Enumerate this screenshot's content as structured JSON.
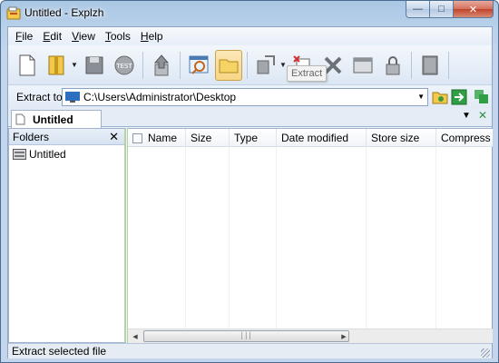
{
  "window": {
    "title": "Untitled - Explzh"
  },
  "menubar": {
    "items": [
      {
        "key": "F",
        "rest": "ile"
      },
      {
        "key": "E",
        "rest": "dit"
      },
      {
        "key": "V",
        "rest": "iew"
      },
      {
        "key": "T",
        "rest": "ools"
      },
      {
        "key": "H",
        "rest": "elp"
      }
    ]
  },
  "toolbar": {
    "tooltip": "Extract"
  },
  "extractbar": {
    "label": "Extract to",
    "path": "C:\\Users\\Administrator\\Desktop"
  },
  "tabs": [
    {
      "label": "Untitled"
    }
  ],
  "folders": {
    "header": "Folders",
    "items": [
      "Untitled"
    ]
  },
  "filelist": {
    "columns": [
      "Name",
      "Size",
      "Type",
      "Date modified",
      "Store size",
      "Compress r"
    ]
  },
  "status": {
    "text": "Extract selected file"
  }
}
